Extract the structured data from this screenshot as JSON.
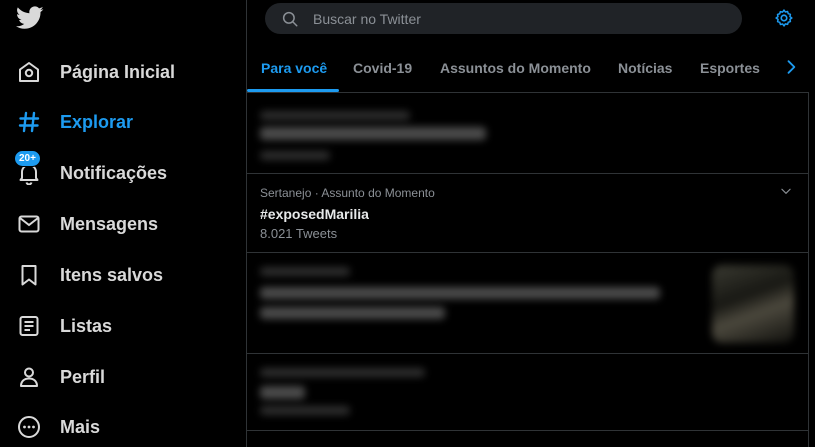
{
  "sidebar": {
    "items": [
      {
        "label": "Página Inicial",
        "icon": "home-icon"
      },
      {
        "label": "Explorar",
        "icon": "hashtag-icon",
        "active": true
      },
      {
        "label": "Notificações",
        "icon": "bell-icon",
        "badge": "20+"
      },
      {
        "label": "Mensagens",
        "icon": "envelope-icon"
      },
      {
        "label": "Itens salvos",
        "icon": "bookmark-icon"
      },
      {
        "label": "Listas",
        "icon": "list-icon"
      },
      {
        "label": "Perfil",
        "icon": "person-icon"
      },
      {
        "label": "Mais",
        "icon": "more-circle-icon"
      }
    ]
  },
  "search": {
    "placeholder": "Buscar no Twitter",
    "value": ""
  },
  "tabs": [
    {
      "label": "Para você",
      "active": true
    },
    {
      "label": "Covid-19"
    },
    {
      "label": "Assuntos do Momento"
    },
    {
      "label": "Notícias"
    },
    {
      "label": "Esportes"
    }
  ],
  "trends": [
    {
      "meta": "",
      "name": "",
      "count": "",
      "blurred": true
    },
    {
      "meta": "Sertanejo · Assunto do Momento",
      "name": "#exposedMarilia",
      "count": "8.021 Tweets",
      "blurred": false
    },
    {
      "meta": "",
      "name": "",
      "count": "",
      "blurred": true
    },
    {
      "meta": "",
      "name": "",
      "count": "",
      "blurred": true
    }
  ],
  "colors": {
    "accent": "#1d9bf0",
    "background": "#000000",
    "muted": "#8b9096"
  }
}
